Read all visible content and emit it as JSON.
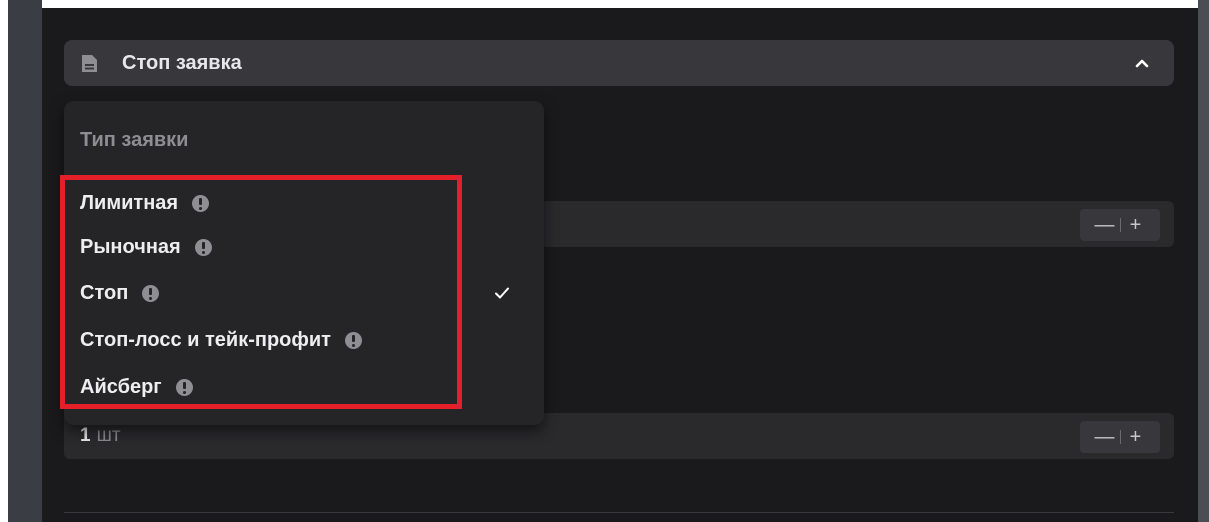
{
  "panel": {
    "title": "Стоп заявка",
    "header_icon": "document-icon",
    "collapse_icon": "chevron-up-icon"
  },
  "dropdown": {
    "heading": "Тип заявки",
    "options": [
      {
        "label": "Лимитная",
        "info": true,
        "selected": false
      },
      {
        "label": "Рыночная",
        "info": true,
        "selected": false
      },
      {
        "label": "Стоп",
        "info": true,
        "selected": true
      },
      {
        "label": "Стоп-лосс и тейк-профит",
        "info": true,
        "selected": false
      },
      {
        "label": "Айсберг",
        "info": true,
        "selected": false
      }
    ]
  },
  "price_field": {
    "minus": "—",
    "plus": "+"
  },
  "quantity_field": {
    "value": "1",
    "unit": "шт",
    "minus": "—",
    "plus": "+"
  },
  "colors": {
    "highlight": "#e3202a",
    "panel_bg": "#1a1a1c",
    "dropdown_bg": "#252528"
  }
}
